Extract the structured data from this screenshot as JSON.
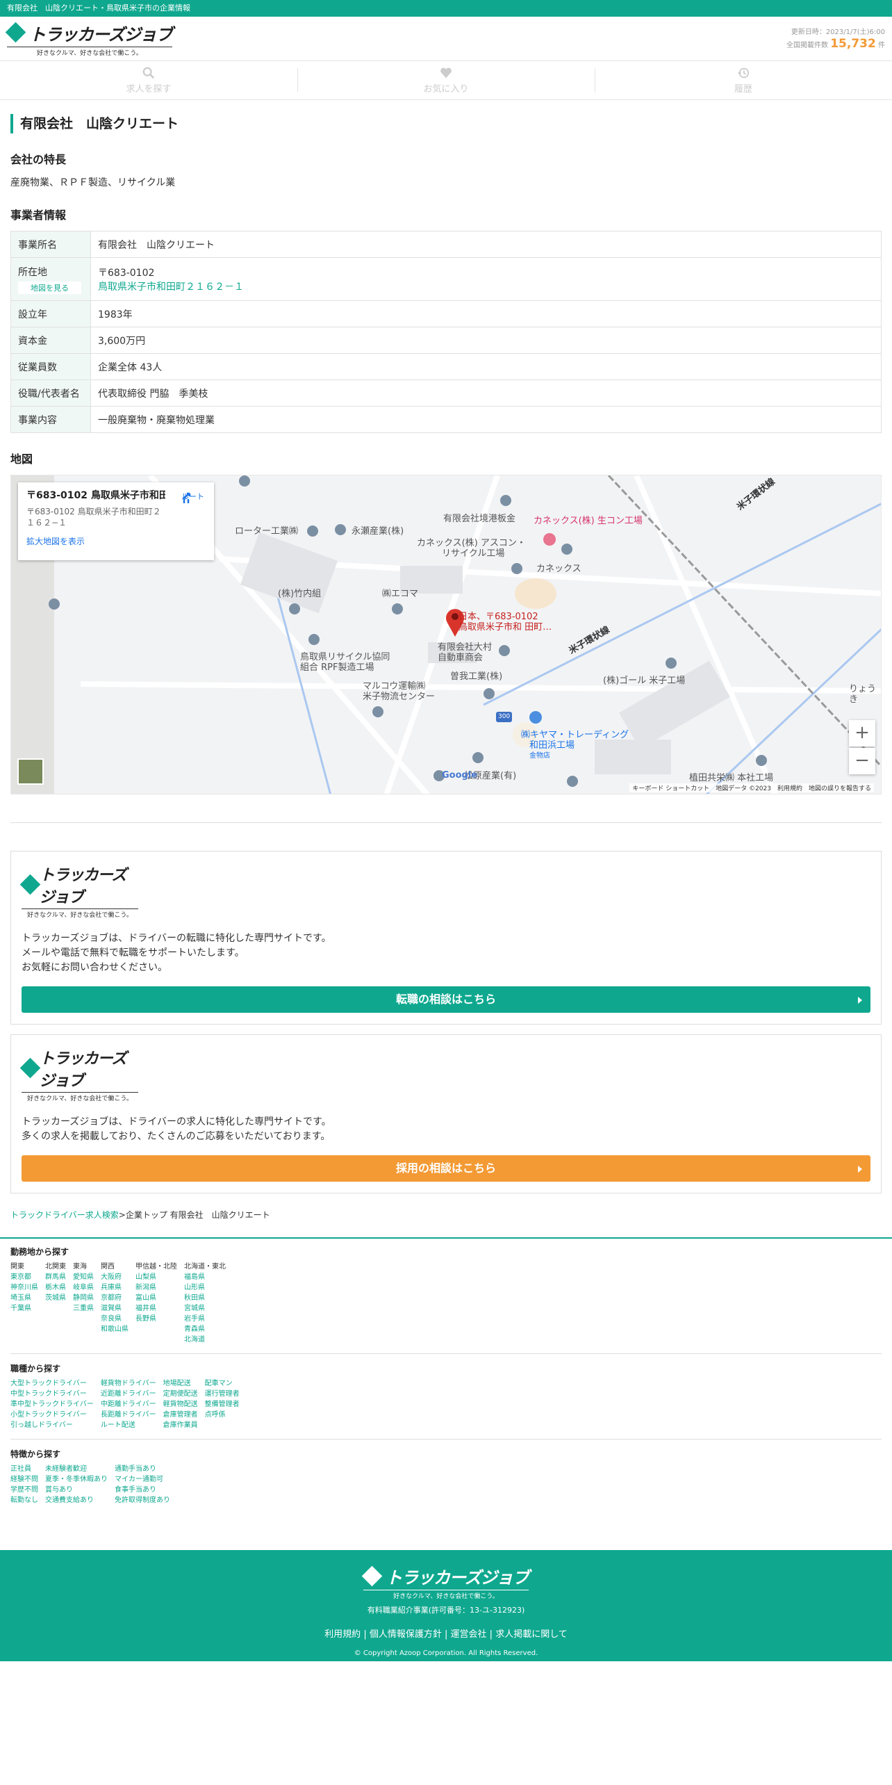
{
  "topbar": {
    "text": "有限会社　山陰クリエート・鳥取県米子市の企業情報"
  },
  "header": {
    "logo": "トラッカーズジョブ",
    "tagline": "好きなクルマ、好きな会社で働こう。",
    "updated": "更新日時：2023/1/7(土)6:00",
    "count_label": "全国掲載件数",
    "count": "15,732",
    "count_unit": "件"
  },
  "nav": [
    {
      "label": "求人を探す",
      "icon": "search-icon"
    },
    {
      "label": "お気に入り",
      "icon": "heart-icon"
    },
    {
      "label": "履歴",
      "icon": "history-icon"
    }
  ],
  "company": {
    "title": "有限会社　山陰クリエート"
  },
  "features": {
    "title": "会社の特長",
    "text": "産廃物業、ＲＰＦ製造、リサイクル業"
  },
  "business": {
    "title": "事業者情報",
    "rows": [
      {
        "label": "事業所名",
        "value": "有限会社　山陰クリエート"
      },
      {
        "label": "所在地",
        "button": "地図を見る",
        "postal": "〒683-0102",
        "address": "鳥取県米子市和田町２１６２－１"
      },
      {
        "label": "設立年",
        "value": "1983年"
      },
      {
        "label": "資本金",
        "value": "3,600万円"
      },
      {
        "label": "従業員数",
        "value": "企業全体 43人"
      },
      {
        "label": "役職/代表者名",
        "value": "代表取締役 門脇　季美枝"
      },
      {
        "label": "事業内容",
        "value": "一般廃棄物・廃棄物処理業"
      }
    ]
  },
  "map": {
    "title": "地図",
    "card_title": "〒683-0102 鳥取県米子市和田…",
    "card_address": "〒683-0102 鳥取県米子市和田町２１６２−１",
    "card_link": "拡大地図を表示",
    "route": "ルート",
    "pin_label_1": "日本、〒683-0102",
    "pin_label_2": "鳥取県米子市和 田町…",
    "labels": {
      "a": "ローター工業㈱",
      "b": "永瀬産業(株)",
      "c": "有限会社境港板金",
      "d": "カネックス(株) 生コン工場",
      "e": "カネックス(株) アスコン・",
      "e2": "リサイクル工場",
      "f": "カネックス",
      "g": "(株)竹内組",
      "h": "㈱エコマ",
      "i": "鳥取県リサイクル協同",
      "i2": "組合 RPF製造工場",
      "j": "有限会社大村",
      "j2": "自動車商会",
      "k": "米子環状線",
      "l": "曽我工業(株)",
      "m": "マルコウ運輸㈱",
      "m2": "米子物流センター",
      "n": "(株)ゴール 米子工場",
      "o": "㈱キヤマ・トレーディング",
      "o2": "和田浜工場",
      "o3": "金物店",
      "p": "松原産業(有)",
      "q": "植田共栄㈱ 本社工場",
      "r": "米子環状線",
      "s": "りょうき",
      "t": "300",
      "google": "Google"
    },
    "zoom_in": "+",
    "zoom_out": "−",
    "footer": "キーボード ショートカット　地図データ ©2023　利用規約　地図の誤りを報告する"
  },
  "promo1": {
    "text": "トラッカーズジョブは、ドライバーの転職に特化した専門サイトです。\nメールや電話で無料で転職をサポートいたします。\nお気軽にお問い合わせください。",
    "cta": "転職の相談はこちら"
  },
  "promo2": {
    "text": "トラッカーズジョブは、ドライバーの求人に特化した専門サイトです。\n多くの求人を掲載しており、たくさんのご応募をいただいております。",
    "cta": "採用の相談はこちら"
  },
  "breadcrumb": {
    "link": "トラックドライバー求人検索",
    "sep": ">",
    "current": "企業トップ 有限会社　山陰クリエート"
  },
  "footer_links": {
    "area_title": "勤務地から探す",
    "areas": [
      {
        "head": "関東",
        "items": [
          "東京都",
          "神奈川県",
          "埼玉県",
          "千葉県"
        ]
      },
      {
        "head": "北関東",
        "items": [
          "群馬県",
          "栃木県",
          "茨城県"
        ]
      },
      {
        "head": "東海",
        "items": [
          "愛知県",
          "岐阜県",
          "静岡県",
          "三重県"
        ]
      },
      {
        "head": "関西",
        "items": [
          "大阪府",
          "兵庫県",
          "京都府",
          "滋賀県",
          "奈良県",
          "和歌山県"
        ]
      },
      {
        "head": "甲信越・北陸",
        "items": [
          "山梨県",
          "新潟県",
          "富山県",
          "福井県",
          "長野県"
        ]
      },
      {
        "head": "北海道・東北",
        "items": [
          "福島県",
          "山形県",
          "秋田県",
          "宮城県",
          "岩手県",
          "青森県",
          "北海道"
        ]
      }
    ],
    "job_title": "職種から探す",
    "jobs": [
      [
        "大型トラックドライバー",
        "中型トラックドライバー",
        "準中型トラックドライバー",
        "小型トラックドライバー",
        "引っ越しドライバー"
      ],
      [
        "軽貨物ドライバー",
        "近距離ドライバー",
        "中距離ドライバー",
        "長距離ドライバー",
        "ルート配送"
      ],
      [
        "地場配送",
        "定期便配送",
        "軽貨物配送",
        "倉庫管理者",
        "倉庫作業員"
      ],
      [
        "配車マン",
        "運行管理者",
        "整備管理者",
        "点呼係"
      ]
    ],
    "feature_title": "特徴から探す",
    "features": [
      [
        "正社員",
        "経験不問",
        "学歴不問",
        "転勤なし"
      ],
      [
        "未経験者歓迎",
        "夏季・冬季休暇あり",
        "賞与あり",
        "交通費支給あり"
      ],
      [
        "通勤手当あり",
        "マイカー通勤可",
        "食事手当あり",
        "免許取得制度あり"
      ]
    ]
  },
  "footer": {
    "logo": "トラッカーズジョブ",
    "tagline": "好きなクルマ、好きな会社で働こう。",
    "license": "有料職業紹介事業(許可番号：13-ユ-312923)",
    "links": [
      "利用規約",
      "個人情報保護方針",
      "運営会社",
      "求人掲載に関して"
    ],
    "copyright": "© Copyright Azoop Corporation. All Rights Reserved."
  }
}
